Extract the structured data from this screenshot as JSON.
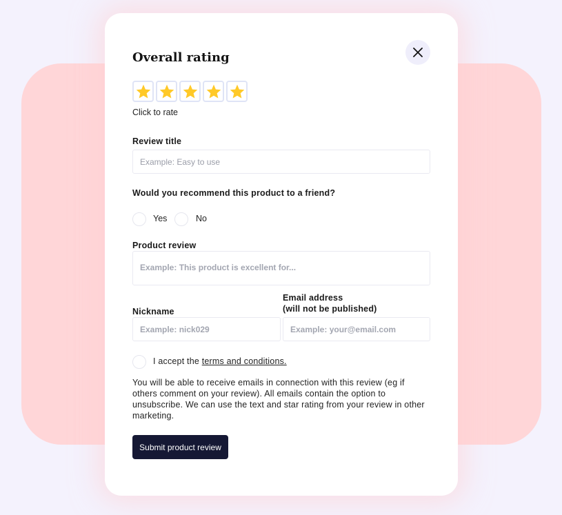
{
  "form": {
    "title": "Overall rating",
    "rating": {
      "value": 5,
      "max": 5,
      "hint": "Click to rate"
    },
    "review_title": {
      "label": "Review title",
      "placeholder": "Example: Easy to use"
    },
    "recommend": {
      "question": "Would you recommend this product to a friend?",
      "options": [
        "Yes",
        "No"
      ]
    },
    "product_review": {
      "label": "Product review",
      "placeholder": "Example: This product is excellent for..."
    },
    "nickname": {
      "label": "Nickname",
      "placeholder": "Example: nick029"
    },
    "email": {
      "label": "Email address",
      "label_note": "(will not be published)",
      "placeholder": "Example: your@email.com"
    },
    "terms": {
      "prefix": "I accept the ",
      "link": "terms and conditions."
    },
    "disclaimer": "You will be able to receive emails in connection with this review (eg if others comment on your review). All emails contain the option to unsubscribe. We can use the text and star rating from your review in other marketing.",
    "submit_label": "Submit product review"
  },
  "colors": {
    "star": "#ffc928",
    "button": "#151834",
    "backdrop": "#ffd6d8",
    "page": "#f4f2fd"
  },
  "icons": {
    "close": "close-icon",
    "star": "star-icon"
  }
}
